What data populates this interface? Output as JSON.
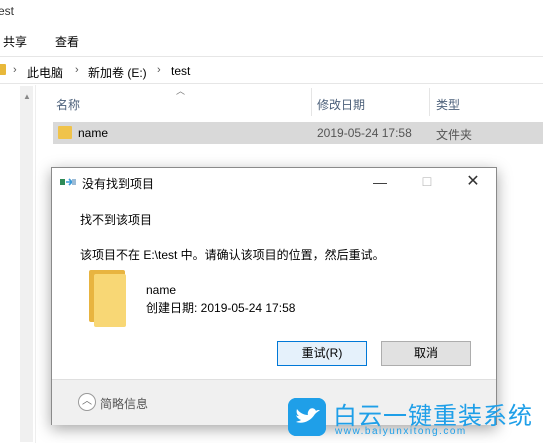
{
  "window": {
    "title_fragment": "est"
  },
  "ribbon": {
    "share": "共享",
    "view": "查看"
  },
  "address": {
    "pc": "此电脑",
    "volume": "新加卷 (E:)",
    "folder": "test"
  },
  "columns": {
    "name": "名称",
    "date": "修改日期",
    "type": "类型"
  },
  "file": {
    "name": "name",
    "modified": "2019-05-24 17:58",
    "type": "文件夹"
  },
  "side": {
    "fragment": ")"
  },
  "dialog": {
    "title": "没有找到项目",
    "heading": "找不到该项目",
    "message": "该项目不在 E:\\test 中。请确认该项目的位置，然后重试。",
    "item_name": "name",
    "item_created": "创建日期: 2019-05-24 17:58",
    "retry": "重试(R)",
    "cancel": "取消",
    "details": "简略信息"
  },
  "watermark": {
    "title": "白云一键重装系统",
    "url": "www.baiyunxitong.com"
  },
  "colors": {
    "accent": "#0078d7",
    "folder": "#f8d775",
    "watermark": "#1f9fe8"
  }
}
